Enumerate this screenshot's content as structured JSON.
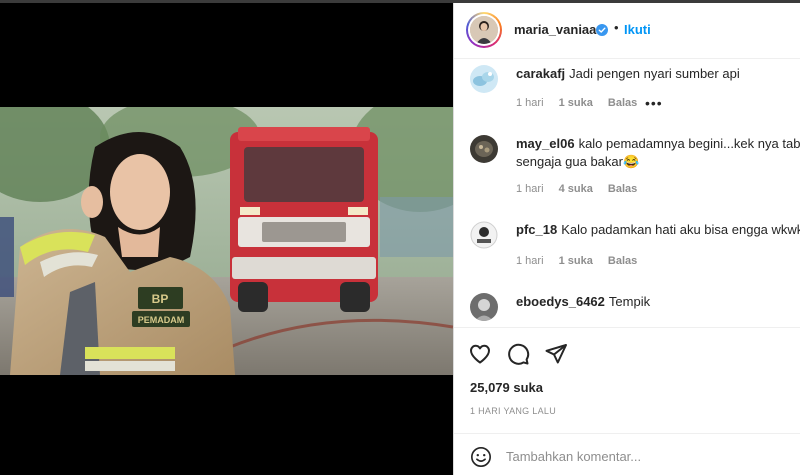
{
  "post": {
    "username": "maria_vaniaa",
    "separator": "•",
    "follow_label": "Ikuti",
    "likes": "25,079 suka",
    "date": "1 HARI YANG LALU",
    "image_badge_text": [
      "BP",
      "PEMADAM"
    ]
  },
  "comments": [
    {
      "username": "carakafj",
      "text": "Jadi pengen nyari sumber api",
      "text2": "",
      "time": "1 hari",
      "likes": "1 suka",
      "reply": "Balas",
      "more": "•••"
    },
    {
      "username": "may_el06",
      "text": "kalo pemadamnya begini...kek nya tabu",
      "text2": "sengaja gua bakar😂",
      "time": "1 hari",
      "likes": "4 suka",
      "reply": "Balas"
    },
    {
      "username": "pfc_18",
      "text": "Kalo padamkan hati aku bisa engga wkwk",
      "text2": "",
      "time": "1 hari",
      "likes": "1 suka",
      "reply": "Balas"
    },
    {
      "username": "eboedys_6462",
      "text": "Tempik",
      "text2": ""
    }
  ],
  "composer": {
    "placeholder": "Tambahkan komentar..."
  },
  "icons": {
    "like": "heart-icon",
    "comment": "comment-icon",
    "share": "share-icon",
    "emoji": "emoji-icon",
    "verified": "verified-badge-icon",
    "more": "more-options-icon"
  },
  "colors": {
    "accent": "#0095f6",
    "text": "#262626",
    "muted": "#8e8e8e",
    "divider": "#efefef"
  }
}
